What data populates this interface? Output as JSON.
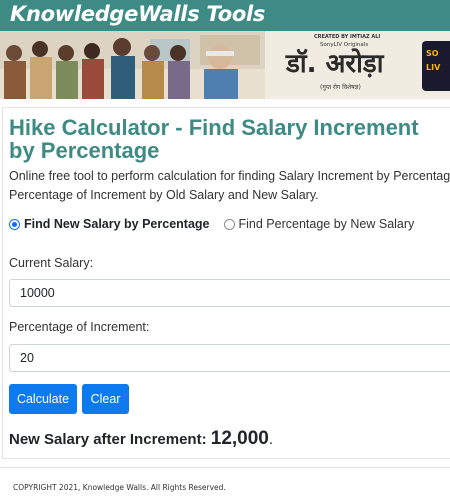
{
  "site": {
    "brand": "KnowledgeWalls Tools"
  },
  "ad": {
    "credit": "CREATED BY IMTIAZ ALI",
    "network": "SonyLIV Originals",
    "show_title": "डॉ. अरोड़ा",
    "tagline": "(गुप्त रोग विशेषज्ञ)",
    "platform_badge": "SO LIV"
  },
  "page": {
    "title": "Hike Calculator - Find Salary Increment by Percentage",
    "description_line1": "Online free tool to perform calculation for finding Salary Increment by Percentage",
    "description_line2": "Percentage of Increment by Old Salary and New Salary."
  },
  "mode": {
    "option1": "Find New Salary by Percentage",
    "option2": "Find Percentage by New Salary",
    "selected": "option1"
  },
  "form": {
    "current_salary_label": "Current Salary:",
    "current_salary_value": "10000",
    "percentage_label": "Percentage of Increment:",
    "percentage_value": "20",
    "calculate_label": "Calculate",
    "clear_label": "Clear"
  },
  "result": {
    "label": "New Salary after Increment:",
    "value": "12,000",
    "suffix": "."
  },
  "footer": {
    "copyright": "COPYRIGHT 2021, Knowledge Walls. All Rights Reserved."
  },
  "colors": {
    "topbar": "#3e8a85",
    "title": "#3e8a85",
    "button": "#0d7bf0"
  }
}
